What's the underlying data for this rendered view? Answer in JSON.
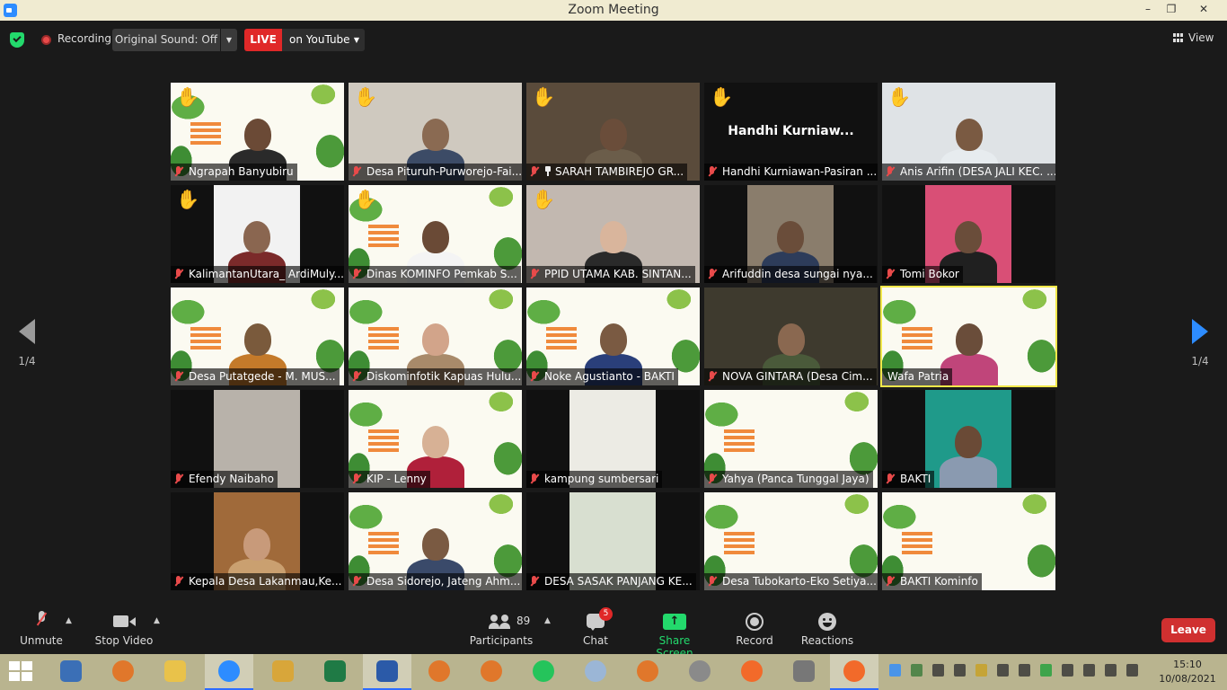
{
  "window": {
    "title": "Zoom Meeting",
    "controls": {
      "minimize": "–",
      "maximize": "❐",
      "close": "✕"
    }
  },
  "topbar": {
    "recording_label": "Recording",
    "original_sound_label": "Original Sound: Off",
    "live_badge": "LIVE",
    "live_destination": "on YouTube",
    "view_label": "View"
  },
  "gallery": {
    "page_indicator_left": "1/4",
    "page_indicator_right": "1/4",
    "participants": [
      {
        "name": "Ngrapah Banyubiru",
        "hand_raised": true
      },
      {
        "name": "Desa Pituruh-Purworejo-Fai...",
        "hand_raised": true
      },
      {
        "name": "SARAH TAMBIREJO GR...",
        "hand_raised": true,
        "pinned": true
      },
      {
        "name": "Handhi Kurniawan-Pasiran ...",
        "hand_raised": true,
        "display_name": "Handhi  Kurniaw..."
      },
      {
        "name": "Anis Arifin (DESA JALI KEC. ...",
        "hand_raised": true
      },
      {
        "name": "KalimantanUtara_ ArdiMuly...",
        "hand_raised": true
      },
      {
        "name": "Dinas KOMINFO Pemkab S...",
        "hand_raised": true
      },
      {
        "name": "PPID UTAMA KAB. SINTAN...",
        "hand_raised": true
      },
      {
        "name": "Arifuddin desa sungai nya..."
      },
      {
        "name": "Tomi Bokor"
      },
      {
        "name": "Desa Putatgede - M. MUS..."
      },
      {
        "name": "Diskominfotik Kapuas Hulu..."
      },
      {
        "name": "Noke Agustianto - BAKTI"
      },
      {
        "name": "NOVA GINTARA (Desa Cim..."
      },
      {
        "name": "Wafa Patria",
        "speaking": true
      },
      {
        "name": "Efendy Naibaho"
      },
      {
        "name": "KIP - Lenny"
      },
      {
        "name": "kampung sumbersari"
      },
      {
        "name": "Yahya (Panca Tunggal Jaya)"
      },
      {
        "name": "BAKTI"
      },
      {
        "name": "Kepala Desa Lakanmau,Ke..."
      },
      {
        "name": "Desa Sidorejo, Jateng Ahm..."
      },
      {
        "name": "DESA SASAK PANJANG KE..."
      },
      {
        "name": "Desa Tubokarto-Eko Setiya..."
      },
      {
        "name": "BAKTI Kominfo"
      }
    ]
  },
  "toolbar": {
    "unmute_label": "Unmute",
    "stop_video_label": "Stop Video",
    "participants_label": "Participants",
    "participants_count": "89",
    "chat_label": "Chat",
    "chat_badge": "5",
    "share_screen_label": "Share Screen",
    "record_label": "Record",
    "reactions_label": "Reactions",
    "leave_label": "Leave"
  },
  "taskbar": {
    "time": "15:10",
    "date": "10/08/2021"
  },
  "colors": {
    "accent_green": "#23d96c",
    "live_red": "#e02828",
    "speaker_outline": "#f1e84a",
    "hand_yellow": "#f5c842",
    "pager_blue": "#2d8cff"
  }
}
